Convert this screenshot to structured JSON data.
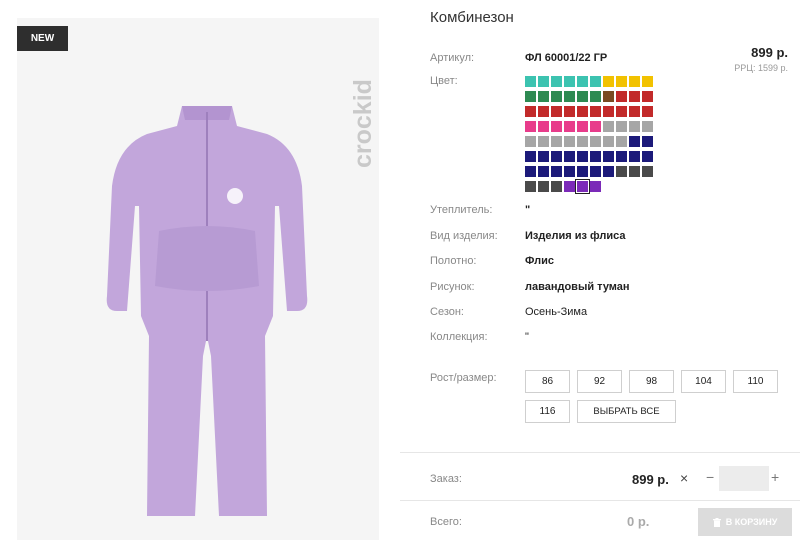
{
  "badge": "NEW",
  "brand": "crockid",
  "product": {
    "title": "Комбинезон",
    "price": "899 р.",
    "rrp": "РРЦ: 1599 р."
  },
  "fields": {
    "article": {
      "label": "Артикул:",
      "value": "ФЛ 60001/22 ГР"
    },
    "color": {
      "label": "Цвет:"
    },
    "filler": {
      "label": "Утеплитель:",
      "value": "\""
    },
    "kind": {
      "label": "Вид изделия:",
      "value": "Изделия из флиса"
    },
    "fabric": {
      "label": "Полотно:",
      "value": "Флис"
    },
    "print": {
      "label": "Рисунок:",
      "value": "лавандовый туман"
    },
    "season": {
      "label": "Сезон:",
      "value": "Осень-Зима"
    },
    "collection": {
      "label": "Коллекция:",
      "value": "\""
    },
    "size": {
      "label": "Рост/размер:"
    }
  },
  "swatch_rows": [
    [
      "#3cc3b0",
      "#3cc3b0",
      "#3cc3b0",
      "#3cc3b0",
      "#3cc3b0",
      "#3cc3b0",
      "#f2c200",
      "#f2c200",
      "#f2c200",
      "#f2c200"
    ],
    [
      "#2e8a52",
      "#2e8a52",
      "#2e8a52",
      "#2e8a52",
      "#2e8a52",
      "#2e8a52",
      "#7a4a22",
      "#c22a2a",
      "#c22a2a",
      "#c22a2a"
    ],
    [
      "#c22a2a",
      "#c22a2a",
      "#c22a2a",
      "#c22a2a",
      "#c22a2a",
      "#c22a2a",
      "#c22a2a",
      "#c22a2a",
      "#c22a2a",
      "#c22a2a"
    ],
    [
      "#e83c8b",
      "#e83c8b",
      "#e83c8b",
      "#e83c8b",
      "#e83c8b",
      "#e83c8b",
      "#a6a6a6",
      "#a6a6a6",
      "#a6a6a6",
      "#a6a6a6"
    ],
    [
      "#a6a6a6",
      "#a6a6a6",
      "#a6a6a6",
      "#a6a6a6",
      "#a6a6a6",
      "#a6a6a6",
      "#a6a6a6",
      "#a6a6a6",
      "#1c1a7a",
      "#1c1a7a"
    ],
    [
      "#1c1a7a",
      "#1c1a7a",
      "#1c1a7a",
      "#1c1a7a",
      "#1c1a7a",
      "#1c1a7a",
      "#1c1a7a",
      "#1c1a7a",
      "#1c1a7a",
      "#1c1a7a"
    ],
    [
      "#1c1a7a",
      "#1c1a7a",
      "#1c1a7a",
      "#1c1a7a",
      "#1c1a7a",
      "#1c1a7a",
      "#1c1a7a",
      "#4a4a4a",
      "#4a4a4a",
      "#4a4a4a"
    ],
    [
      "#4a4a4a",
      "#4a4a4a",
      "#4a4a4a",
      "#7b2ab8",
      "#7b2ab8",
      "#7b2ab8"
    ]
  ],
  "selected_swatch": {
    "row": 7,
    "col": 4
  },
  "sizes": [
    "86",
    "92",
    "98",
    "104",
    "110",
    "116"
  ],
  "select_all_label": "ВЫБРАТЬ ВСЕ",
  "order": {
    "label": "Заказ:",
    "price": "899 р.",
    "clear": "×",
    "minus": "−",
    "plus": "+"
  },
  "total": {
    "label": "Всего:",
    "price": "0 р.",
    "cart_label": "В КОРЗИНУ"
  }
}
